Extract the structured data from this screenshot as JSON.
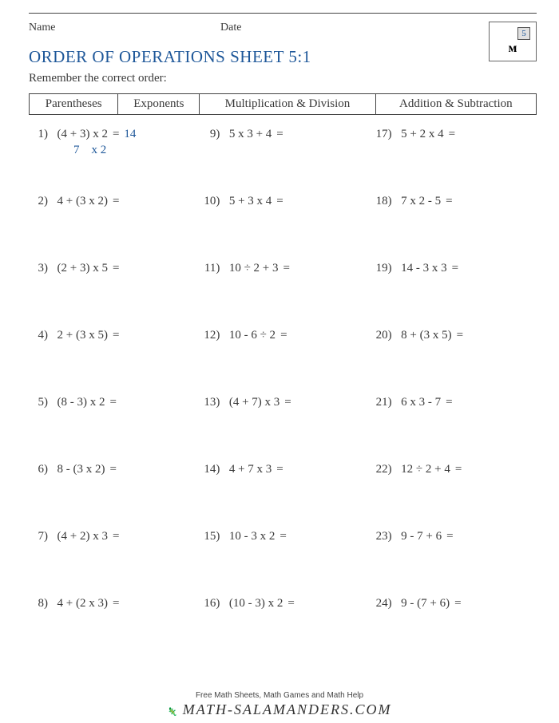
{
  "header": {
    "name_label": "Name",
    "date_label": "Date",
    "grade": "5"
  },
  "title": "ORDER OF OPERATIONS SHEET 5:1",
  "subtitle": "Remember the correct order:",
  "rule_table": [
    "Parentheses",
    "Exponents",
    "Multiplication & Division",
    "Addition & Subtraction"
  ],
  "example": {
    "answer": "14",
    "work": "7    x 2"
  },
  "problems": [
    {
      "n": "1)",
      "expr": "(4 + 3) x 2",
      "ans": "14"
    },
    {
      "n": "2)",
      "expr": "4 + (3 x 2)",
      "ans": ""
    },
    {
      "n": "3)",
      "expr": "(2 + 3) x 5",
      "ans": ""
    },
    {
      "n": "4)",
      "expr": "2 + (3 x 5)",
      "ans": ""
    },
    {
      "n": "5)",
      "expr": "(8 - 3) x 2",
      "ans": ""
    },
    {
      "n": "6)",
      "expr": "8 - (3 x 2)",
      "ans": ""
    },
    {
      "n": "7)",
      "expr": "(4 + 2) x 3",
      "ans": ""
    },
    {
      "n": "8)",
      "expr": "4 + (2 x 3)",
      "ans": ""
    },
    {
      "n": "9)",
      "expr": "5 x 3 + 4",
      "ans": ""
    },
    {
      "n": "10)",
      "expr": "5 + 3 x 4",
      "ans": ""
    },
    {
      "n": "11)",
      "expr": "10 ÷ 2 + 3",
      "ans": ""
    },
    {
      "n": "12)",
      "expr": "10 - 6 ÷ 2",
      "ans": ""
    },
    {
      "n": "13)",
      "expr": "(4 + 7) x 3",
      "ans": ""
    },
    {
      "n": "14)",
      "expr": "4 + 7 x 3",
      "ans": ""
    },
    {
      "n": "15)",
      "expr": "10 - 3 x 2",
      "ans": ""
    },
    {
      "n": "16)",
      "expr": "(10 - 3) x 2",
      "ans": ""
    },
    {
      "n": "17)",
      "expr": "5 + 2 x 4",
      "ans": ""
    },
    {
      "n": "18)",
      "expr": "7 x 2 - 5",
      "ans": ""
    },
    {
      "n": "19)",
      "expr": "14 - 3 x 3",
      "ans": ""
    },
    {
      "n": "20)",
      "expr": "8 + (3 x 5)",
      "ans": ""
    },
    {
      "n": "21)",
      "expr": "6 x 3 - 7",
      "ans": ""
    },
    {
      "n": "22)",
      "expr": "12 ÷ 2 + 4",
      "ans": ""
    },
    {
      "n": "23)",
      "expr": "9 - 7 + 6",
      "ans": ""
    },
    {
      "n": "24)",
      "expr": "9 - (7 + 6)",
      "ans": ""
    }
  ],
  "footer": {
    "tagline": "Free Math Sheets, Math Games and Math Help",
    "brand": "MATH-SALAMANDERS.COM"
  }
}
